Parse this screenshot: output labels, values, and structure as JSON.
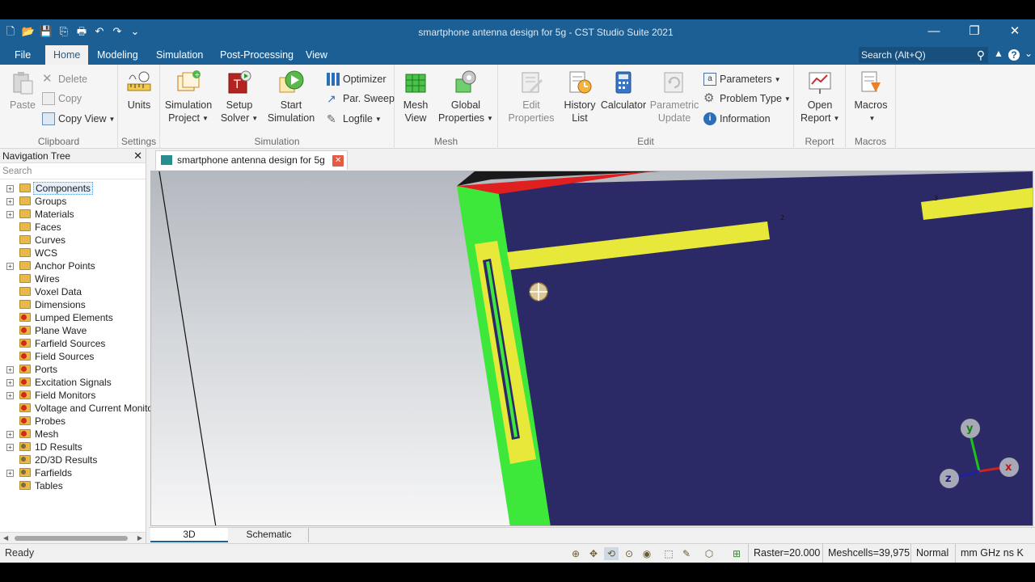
{
  "window": {
    "title": "smartphone antenna design for 5g - CST Studio Suite 2021",
    "controls": [
      "—",
      "❐",
      "✕"
    ]
  },
  "quick_access": [
    "🗋",
    "📂",
    "💾",
    "⎘",
    "🖶",
    "↶",
    "↷",
    "⌄"
  ],
  "menu": {
    "tabs": [
      "File",
      "Home",
      "Modeling",
      "Simulation",
      "Post-Processing",
      "View"
    ],
    "active_tab": "Home",
    "search_placeholder": "Search (Alt+Q)",
    "search_icon": "⚲",
    "collapse_icon": "▲",
    "help_icon": "?",
    "options_icon": "⌄"
  },
  "ribbon": {
    "clipboard": {
      "label": "Clipboard",
      "paste": "Paste",
      "delete": "Delete",
      "copy": "Copy",
      "copy_view": "Copy View"
    },
    "settings": {
      "label": "Settings",
      "units": "Units"
    },
    "simulation": {
      "label": "Simulation",
      "sim_project_1": "Simulation",
      "sim_project_2": "Project",
      "setup_solver_1": "Setup",
      "setup_solver_2": "Solver",
      "start_sim_1": "Start",
      "start_sim_2": "Simulation",
      "optimizer": "Optimizer",
      "par_sweep": "Par. Sweep",
      "logfile": "Logfile"
    },
    "mesh": {
      "label": "Mesh",
      "mesh_view_1": "Mesh",
      "mesh_view_2": "View",
      "global_props_1": "Global",
      "global_props_2": "Properties"
    },
    "edit": {
      "label": "Edit",
      "edit_props_1": "Edit",
      "edit_props_2": "Properties",
      "history_1": "History",
      "history_2": "List",
      "calculator": "Calculator",
      "param_update_1": "Parametric",
      "param_update_2": "Update",
      "parameters": "Parameters",
      "problem_type": "Problem Type",
      "information": "Information"
    },
    "report": {
      "label": "Report",
      "open_report_1": "Open",
      "open_report_2": "Report"
    },
    "macros": {
      "label": "Macros",
      "macros": "Macros"
    }
  },
  "nav": {
    "title": "Navigation Tree",
    "close": "✕",
    "search_placeholder": "Search",
    "items": [
      {
        "label": "Components",
        "exp": true,
        "icon": "folder",
        "selected": true
      },
      {
        "label": "Groups",
        "exp": true,
        "icon": "folder"
      },
      {
        "label": "Materials",
        "exp": true,
        "icon": "folder"
      },
      {
        "label": "Faces",
        "exp": false,
        "icon": "folder"
      },
      {
        "label": "Curves",
        "exp": false,
        "icon": "folder"
      },
      {
        "label": "WCS",
        "exp": false,
        "icon": "folder"
      },
      {
        "label": "Anchor Points",
        "exp": true,
        "icon": "folder"
      },
      {
        "label": "Wires",
        "exp": false,
        "icon": "folder"
      },
      {
        "label": "Voxel Data",
        "exp": false,
        "icon": "folder"
      },
      {
        "label": "Dimensions",
        "exp": false,
        "icon": "folder"
      },
      {
        "label": "Lumped Elements",
        "exp": false,
        "icon": "red"
      },
      {
        "label": "Plane Wave",
        "exp": false,
        "icon": "red"
      },
      {
        "label": "Farfield Sources",
        "exp": false,
        "icon": "red"
      },
      {
        "label": "Field Sources",
        "exp": false,
        "icon": "red"
      },
      {
        "label": "Ports",
        "exp": true,
        "icon": "red"
      },
      {
        "label": "Excitation Signals",
        "exp": true,
        "icon": "red"
      },
      {
        "label": "Field Monitors",
        "exp": true,
        "icon": "red"
      },
      {
        "label": "Voltage and Current Monitors",
        "exp": false,
        "icon": "red"
      },
      {
        "label": "Probes",
        "exp": false,
        "icon": "red"
      },
      {
        "label": "Mesh",
        "exp": true,
        "icon": "red"
      },
      {
        "label": "1D Results",
        "exp": true,
        "icon": "gear"
      },
      {
        "label": "2D/3D Results",
        "exp": false,
        "icon": "gear"
      },
      {
        "label": "Farfields",
        "exp": true,
        "icon": "gear"
      },
      {
        "label": "Tables",
        "exp": false,
        "icon": "gear"
      }
    ],
    "scroll_left": "◀",
    "scroll_right": "▶"
  },
  "document_tab": {
    "title": "smartphone antenna design for 5g",
    "close": "✕"
  },
  "viewport": {
    "port_labels": [
      "2",
      "3"
    ],
    "axes": {
      "x": "x",
      "y": "y",
      "z": "z"
    }
  },
  "view_tabs": [
    "3D",
    "Schematic"
  ],
  "status": {
    "ready": "Ready",
    "tools": [
      "⊕",
      "✥",
      "⟲",
      "⊙",
      "◉",
      "⬚",
      "✎",
      "⬡",
      "⊞"
    ],
    "raster": "Raster=20.000",
    "meshcells": "Meshcells=39,975",
    "mode": "Normal",
    "units": "mm  GHz  ns  K"
  },
  "colors": {
    "titlebar": "#1c5f94",
    "substrate": "#2c2a66",
    "board_edge": "#3ee83a",
    "antenna": "#e8e83a",
    "ground_edge": "#e02020"
  }
}
